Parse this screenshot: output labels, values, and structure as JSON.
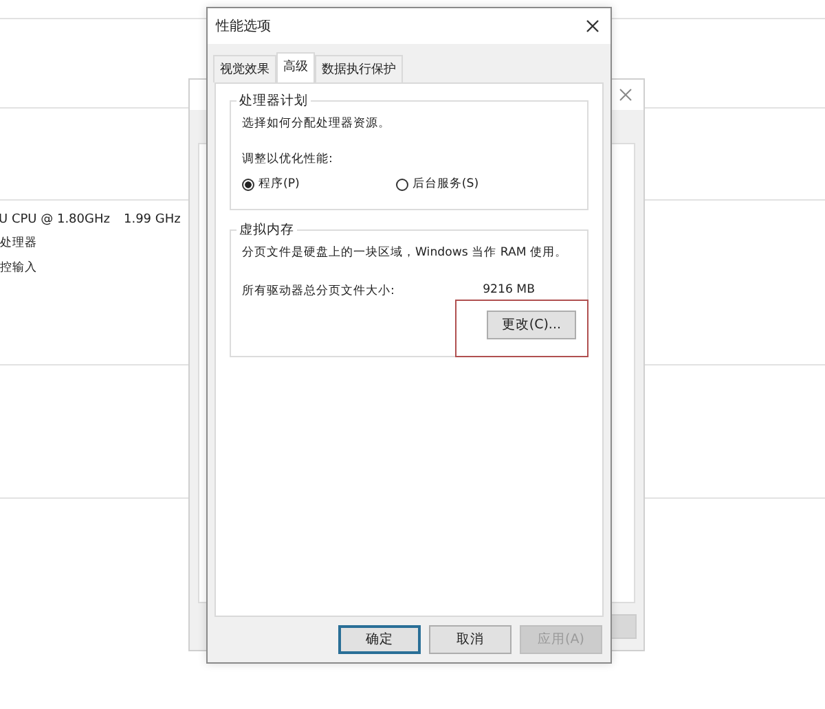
{
  "background": {
    "texts": [
      {
        "text": "U CPU @ 1.80GHz"
      },
      {
        "text": "1.99 GHz"
      },
      {
        "text": "处理器"
      },
      {
        "text": "控输入"
      }
    ]
  },
  "dialog": {
    "title": "性能选项",
    "tabs": [
      {
        "label": "视觉效果",
        "selected": false
      },
      {
        "label": "高级",
        "selected": true
      },
      {
        "label": "数据执行保护",
        "selected": false
      }
    ],
    "processor_group": {
      "title": "处理器计划",
      "description": "选择如何分配处理器资源。",
      "prompt": "调整以优化性能:",
      "options": [
        {
          "label": "程序(P)",
          "selected": true
        },
        {
          "label": "后台服务(S)",
          "selected": false
        }
      ]
    },
    "memory_group": {
      "title": "虚拟内存",
      "description": "分页文件是硬盘上的一块区域，Windows 当作 RAM 使用。",
      "size_label": "所有驱动器总分页文件大小:",
      "size_value": "9216 MB",
      "change_button": {
        "label": "更改(C)...",
        "highlighted": true
      }
    },
    "buttons": [
      {
        "label": "确定",
        "default": true,
        "disabled": false
      },
      {
        "label": "取消",
        "default": false,
        "disabled": false
      },
      {
        "label": "应用(A)",
        "default": false,
        "disabled": true
      }
    ]
  }
}
